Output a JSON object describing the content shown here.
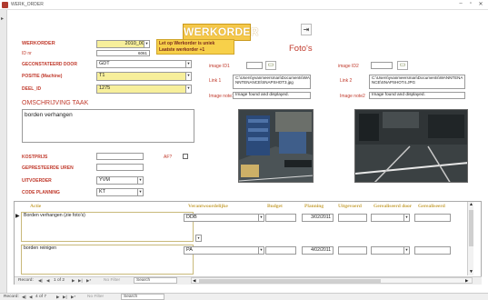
{
  "window": {
    "title": "WERK_ORDER",
    "min": "–",
    "max": "▫",
    "close": "✕"
  },
  "header": {
    "button_label": "WERKORDER",
    "exit_icon": "exit-door-icon"
  },
  "warning": {
    "line1": "Let op Werkorder is uniek",
    "line2": "Laatste werkorder +1"
  },
  "form": {
    "werkorder_label": "WERKORDER",
    "werkorder_value": "2010_005",
    "idnr_label": "ID nr",
    "idnr_value": "6061",
    "gecontstateerd_label": "GECONSTATEERD DOOR",
    "gecontstateerd_value": "GDT",
    "positie_label": "POSITIE (Machine)",
    "positie_value": "T1",
    "deel_label": "DEEL_ID",
    "deel_value": "1275",
    "omschrijving_label": "OMSCHRIJVING TAAK",
    "omschrijving_value": "borden verhangen",
    "kostprijs_label": "KOSTPRIJS",
    "kostprijs_value": "",
    "afp_label": "AF?",
    "gepresteerde_label": "GEPRESTEERDE UREN",
    "gepresteerde_value": "",
    "uitvoerder_label": "UITVOERDER",
    "uitvoerder_value": "YVM",
    "codeplanning_label": "CODE PLANNING",
    "codeplanning_value": "KT"
  },
  "fotos": {
    "title": "Foto's",
    "image1_label": "image ID1",
    "image2_label": "image ID2",
    "link1_label": "Link 1",
    "link1_value": "C:\\Users\\yvanmeersman\\Documents\\WANNTENANCE\\SNAPSHOT3.jpg",
    "link2_label": "Link 2",
    "link2_value": "C:\\Users\\yvanmeersman\\Documents\\WANNTENANCE\\SNAPSHOT4.JPG",
    "note1_label": "Image note1",
    "note1_value": "Image found and displayed.",
    "note2_label": "Image note2",
    "note2_value": "Image found and displayed."
  },
  "subform": {
    "headers": [
      "Actie",
      "Verantwoordelijke",
      "Budget",
      "Planning",
      "Uitgevoerd",
      "Gerealiseerd door",
      "Gerealiseerd"
    ],
    "rows": [
      {
        "actie": "Borden verhangen (zie foto's)",
        "verantwoordelijke": "DDB",
        "budget": "",
        "planning": "3/02/2011",
        "uitgevoerd": "",
        "gerealiseerd_door": "",
        "gerealiseerd": ""
      },
      {
        "actie": "borden reinigen",
        "verantwoordelijke": "PA",
        "budget": "",
        "planning": "4/02/2011",
        "uitgevoerd": "",
        "gerealiseerd_door": "",
        "gerealiseerd": ""
      }
    ],
    "nav": {
      "record_label": "Record:",
      "position": "1 of 2",
      "filter": "No Filter",
      "search": "Search"
    }
  },
  "mainnav": {
    "record_label": "Record:",
    "position": "4 of 7",
    "filter": "No Filter",
    "search": "Search"
  },
  "colors": {
    "accent": "#f5c84a",
    "label_red": "#c0392b",
    "field_yellow": "#f7ef9b"
  }
}
